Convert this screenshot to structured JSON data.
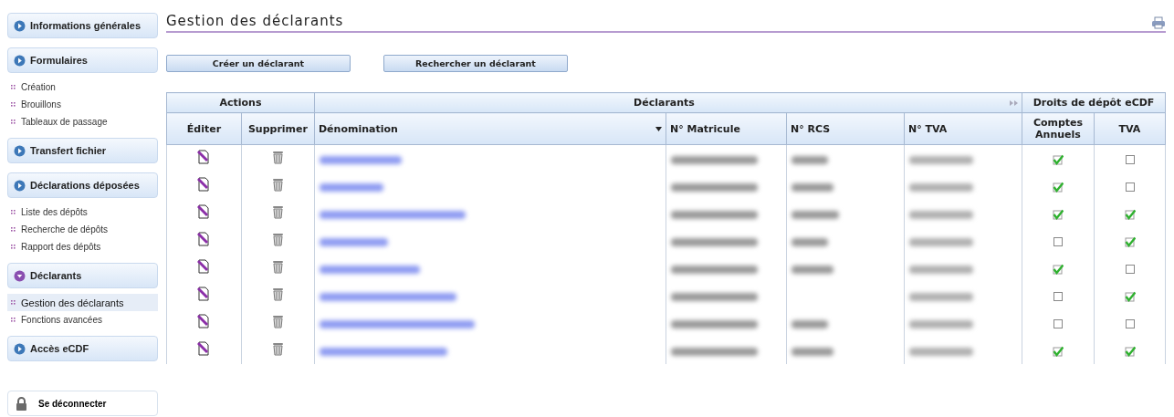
{
  "sidebar": {
    "sections": [
      {
        "label": "Informations générales",
        "expanded": false
      },
      {
        "label": "Formulaires",
        "expanded": false,
        "items": [
          {
            "label": "Création",
            "selected": false
          },
          {
            "label": "Brouillons",
            "selected": false
          },
          {
            "label": "Tableaux de passage",
            "selected": false
          }
        ]
      },
      {
        "label": "Transfert fichier",
        "expanded": false
      },
      {
        "label": "Déclarations déposées",
        "expanded": false,
        "items": [
          {
            "label": "Liste des dépôts",
            "selected": false
          },
          {
            "label": "Recherche de dépôts",
            "selected": false
          },
          {
            "label": "Rapport des dépôts",
            "selected": false
          }
        ]
      },
      {
        "label": "Déclarants",
        "expanded": true,
        "items": [
          {
            "label": "Gestion des déclarants",
            "selected": true
          },
          {
            "label": "Fonctions avancées",
            "selected": false
          }
        ]
      },
      {
        "label": "Accès eCDF",
        "expanded": false
      }
    ],
    "logout": "Se déconnecter"
  },
  "page": {
    "title": "Gestion des déclarants"
  },
  "buttons": [
    "Créer un déclarant",
    "Rechercher un déclarant"
  ],
  "table": {
    "groups": [
      "Actions",
      "Déclarants",
      "Droits de dépôt eCDF"
    ],
    "columns": [
      "Éditer",
      "Supprimer",
      "Dénomination",
      "N° Matricule",
      "N° RCS",
      "N° TVA",
      "Comptes Annuels",
      "TVA"
    ],
    "rows": [
      {
        "has_rcs": true,
        "comptes_annuels": true,
        "tva": false
      },
      {
        "has_rcs": true,
        "comptes_annuels": true,
        "tva": false
      },
      {
        "has_rcs": true,
        "comptes_annuels": true,
        "tva": true
      },
      {
        "has_rcs": true,
        "comptes_annuels": false,
        "tva": true
      },
      {
        "has_rcs": true,
        "comptes_annuels": true,
        "tva": false
      },
      {
        "has_rcs": false,
        "comptes_annuels": false,
        "tva": true
      },
      {
        "has_rcs": true,
        "comptes_annuels": false,
        "tva": false
      },
      {
        "has_rcs": true,
        "comptes_annuels": true,
        "tva": true
      }
    ]
  }
}
